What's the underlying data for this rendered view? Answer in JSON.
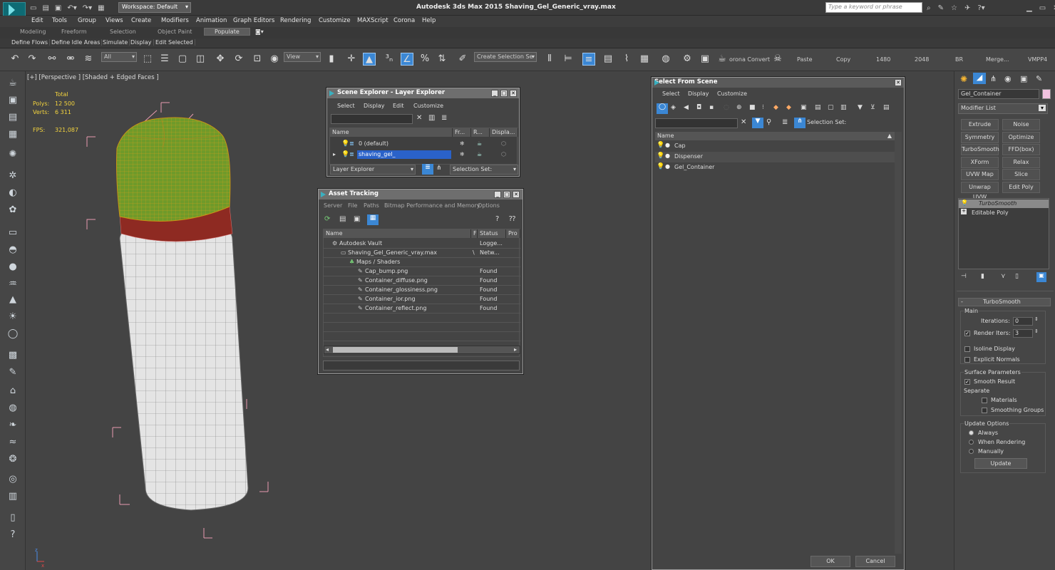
{
  "app": {
    "logo_label": "MAX",
    "workspace": "Workspace: Default",
    "title": "Autodesk 3ds Max  2015     Shaving_Gel_Generic_vray.max",
    "search_placeholder": "Type a keyword or phrase"
  },
  "menu": [
    "Edit",
    "Tools",
    "Group",
    "Views",
    "Create",
    "Modifiers",
    "Animation",
    "Graph Editors",
    "Rendering",
    "Customize",
    "MAXScript",
    "Corona",
    "Help"
  ],
  "ribbon_tabs": [
    "Modeling",
    "Freeform",
    "Selection",
    "Object Paint",
    "Populate"
  ],
  "ribbon_row2": [
    "Define Flows",
    "Define Idle Areas",
    "Simulate",
    "Display",
    "Edit Selected"
  ],
  "toolbar": {
    "filter": "All",
    "ref_coord": "View",
    "selection_set": "Create Selection Se",
    "corona_convert": "orona Convert",
    "paste": "Paste",
    "copy": "Copy",
    "w": "1480",
    "h": "2048",
    "br": "BR",
    "merge": "Merge...",
    "vmpp": "VMPP4"
  },
  "viewport": {
    "label": "[+] [Perspective ] [Shaded + Edged Faces ]",
    "total": "Total",
    "polys_label": "Polys:",
    "polys": "12 500",
    "verts_label": "Verts:",
    "verts": "6 311",
    "fps_label": "FPS:",
    "fps": "321,087"
  },
  "scene_explorer": {
    "title": "Scene Explorer - Layer Explorer",
    "menu": [
      "Select",
      "Display",
      "Edit",
      "Customize"
    ],
    "columns": [
      "Name",
      "Fr...",
      "R...",
      "Displa..."
    ],
    "rows": [
      {
        "name": "0 (default)",
        "selected": false
      },
      {
        "name": "shaving_gel_",
        "selected": true
      }
    ],
    "footer_dropdown": "Layer Explorer",
    "footer_selset": "Selection Set:"
  },
  "asset_tracking": {
    "title": "Asset Tracking",
    "menu": [
      "Server",
      "File",
      "Paths",
      "Bitmap Performance and Memory",
      "Options"
    ],
    "columns": [
      "Name",
      "F",
      "Status",
      "Pro"
    ],
    "rows": [
      {
        "name": "Autodesk Vault",
        "f": "",
        "status": "Logge...",
        "indent": 1
      },
      {
        "name": "Shaving_Gel_Generic_vray.max",
        "f": "\\",
        "status": "Netw...",
        "indent": 2
      },
      {
        "name": "Maps / Shaders",
        "f": "",
        "status": "",
        "indent": 3
      },
      {
        "name": "Cap_bump.png",
        "f": "",
        "status": "Found",
        "indent": 4
      },
      {
        "name": "Container_diffuse.png",
        "f": "",
        "status": "Found",
        "indent": 4
      },
      {
        "name": "Container_glossiness.png",
        "f": "",
        "status": "Found",
        "indent": 4
      },
      {
        "name": "Container_ior.png",
        "f": "",
        "status": "Found",
        "indent": 4
      },
      {
        "name": "Container_reflect.png",
        "f": "",
        "status": "Found",
        "indent": 4
      }
    ]
  },
  "select_from_scene": {
    "title": "Select From Scene",
    "menu": [
      "Select",
      "Display",
      "Customize"
    ],
    "selection_set": "Selection Set:",
    "column": "Name",
    "rows": [
      "Cap",
      "Dispenser",
      "Gel_Container"
    ],
    "ok": "OK",
    "cancel": "Cancel"
  },
  "command_panel": {
    "object_name": "Gel_Container",
    "modifier_list": "Modifier List",
    "buttons": [
      "Extrude",
      "Noise",
      "Symmetry",
      "Optimize",
      "TurboSmooth",
      "FFD(box)",
      "XForm",
      "Relax",
      "UVW Map",
      "Slice",
      "Unwrap UVW",
      "Edit Poly"
    ],
    "stack": [
      "TurboSmooth",
      "Editable Poly"
    ],
    "rollout_title": "TurboSmooth",
    "main_label": "Main",
    "iterations_label": "Iterations:",
    "iterations": "0",
    "render_iters_label": "Render Iters:",
    "render_iters": "3",
    "isoline": "Isoline Display",
    "explicit_normals": "Explicit Normals",
    "surface_params": "Surface Parameters",
    "smooth_result": "Smooth Result",
    "separate": "Separate",
    "materials": "Materials",
    "smoothing_groups": "Smoothing Groups",
    "update_options": "Update Options",
    "always": "Always",
    "when_rendering": "When Rendering",
    "manually": "Manually",
    "update": "Update",
    "color_swatch": "#f2c2e0"
  },
  "colors": {
    "accent": "#2a62c9",
    "bbox": "#e89ab0",
    "mesh_green": "#6f9a2a",
    "stat_yellow": "#f3d33e"
  }
}
